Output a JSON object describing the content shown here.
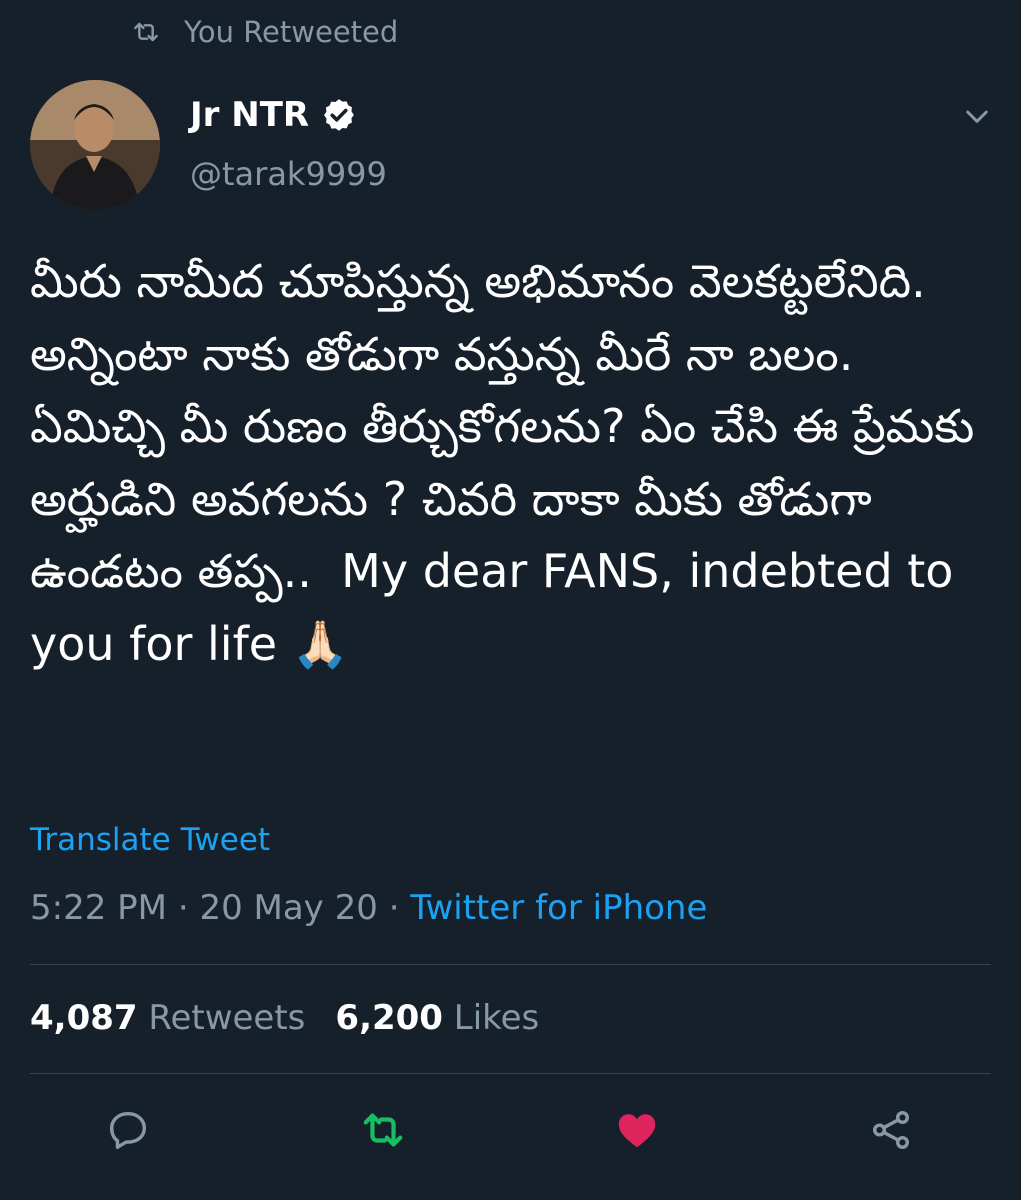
{
  "context": {
    "label": "You Retweeted",
    "icon": "retweet-icon"
  },
  "author": {
    "name": "Jr NTR",
    "handle": "@tarak9999",
    "verified": true,
    "avatar_icon": "avatar"
  },
  "tweet": {
    "text": "మీరు నామీద చూపిస్తున్న అభిమానం వెలకట్టలేనిది. అన్నింటా నాకు తోడుగా వస్తున్న మీరే నా బలం. ఏమిచ్చి మీ రుణం తీర్చుకోగలను? ఏం చేసి ఈ ప్రేమకు అర్హుడిని అవగలను ? చివరి దాకా మీకు తోడుగా ఉండటం తప్ప..  My dear FANS, indebted to you for life 🙏🏻",
    "translate_label": "Translate Tweet",
    "time": "5:22 PM",
    "date": "20 May 20",
    "source": "Twitter for iPhone",
    "separator": "·"
  },
  "stats": {
    "retweets_count": "4,087",
    "retweets_label": "Retweets",
    "likes_count": "6,200",
    "likes_label": "Likes"
  },
  "actions": [
    "reply-icon",
    "retweet-icon",
    "like-icon",
    "share-icon"
  ],
  "colors": {
    "background": "#15202b",
    "text": "#ffffff",
    "muted": "#8899a6",
    "link": "#1da1f2",
    "retweet_active": "#17bf63",
    "like_active": "#e0245e"
  }
}
